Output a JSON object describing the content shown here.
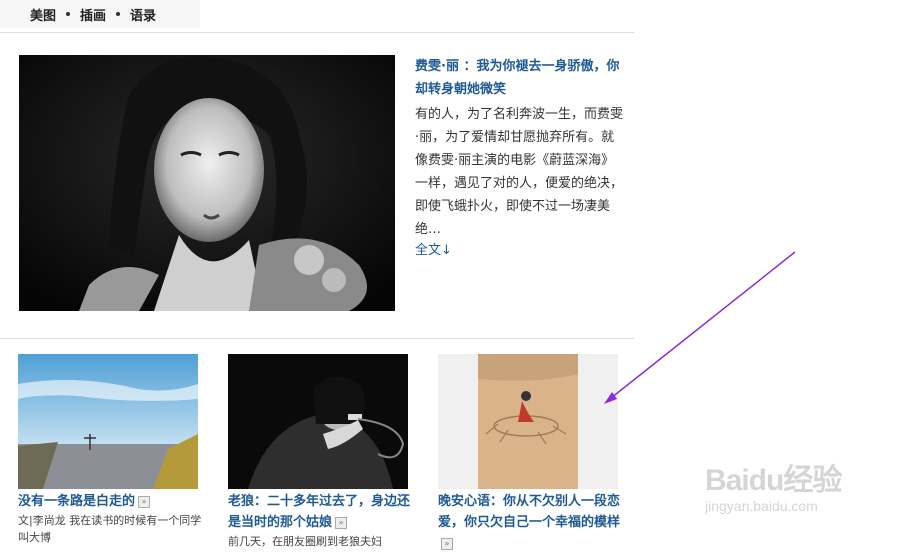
{
  "nav": {
    "items": [
      "美图",
      "插画",
      "语录"
    ]
  },
  "feature": {
    "title": "费雯·丽 ：我为你褪去一身骄傲，你却转身朝她微笑",
    "summary": "有的人，为了名利奔波一生，而费雯·丽，为了爱情却甘愿抛弃所有。就像费雯·丽主演的电影《蔚蓝深海》一样，遇见了对的人，便爱的绝决，即使飞蛾扑火，即使不过一场凄美绝…",
    "read_more": "全文↓"
  },
  "cards": [
    {
      "title": "没有一条路是白走的",
      "desc": "文|李尚龙 我在读书的时候有一个同学叫大博"
    },
    {
      "title": "老狼：二十多年过去了，身边还是当时的那个姑娘",
      "desc": "前几天，在朋友圈刷到老狼夫妇"
    },
    {
      "title": "晚安心语：你从不欠别人一段恋爱，你只欠自己一个幸福的模样",
      "desc": ""
    }
  ],
  "watermark": {
    "line1": "Baidu经验",
    "line2": "jingyan.baidu.com"
  },
  "colors": {
    "link": "#1f5a95",
    "annotation_arrow": "#8a2be2"
  }
}
